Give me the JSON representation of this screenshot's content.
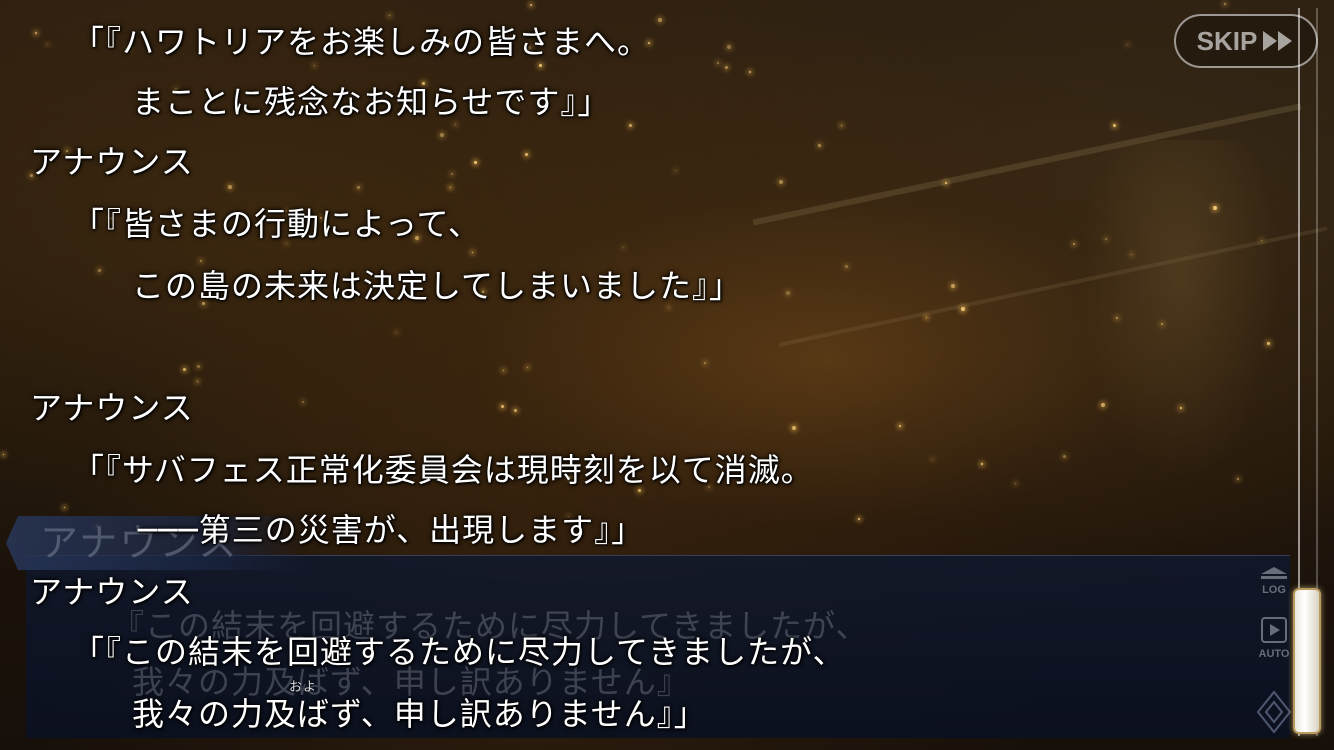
{
  "skip": {
    "label": "SKIP"
  },
  "log": {
    "entries": [
      {
        "speaker": "",
        "lines": [
          "「『ハワトリアをお楽しみの皆さまへ。",
          "まことに残念なお知らせです』」"
        ]
      },
      {
        "speaker": "アナウンス",
        "lines": [
          "「『皆さまの行動によって、",
          "この島の未来は決定してしまいました』」"
        ]
      },
      {
        "speaker": "アナウンス",
        "lines": [
          "「『サバフェス正常化委員会は現時刻を以て消滅。",
          "───第三の災害が、出現します』」"
        ]
      },
      {
        "speaker": "アナウンス",
        "lines": [
          "「『この結末を回避するために尽力してきましたが、",
          "我々の力及ばず、申し訳ありません』」"
        ]
      }
    ],
    "ruby": "およ"
  },
  "message_window": {
    "speaker": "アナウンス",
    "lines": [
      "『この結末を回避するために尽力してきましたが、",
      "我々の力及ばず、申し訳ありません』"
    ]
  },
  "side_controls": {
    "log_label": "LOG",
    "auto_label": "AUTO"
  },
  "colors": {
    "text": "#ffffff",
    "window": "#101a30",
    "scroll_thumb_border": "#b89a5e"
  }
}
